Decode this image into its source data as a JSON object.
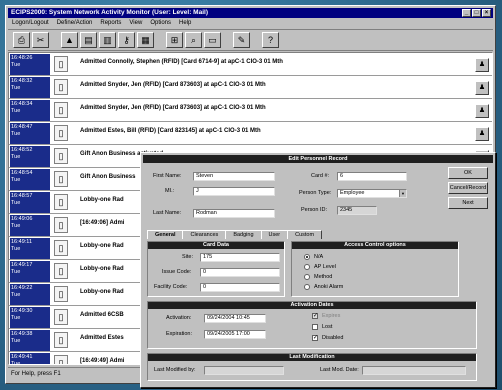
{
  "window": {
    "title": "ECIPS2000: System Network Activity Monitor (User: Level: Mail)",
    "controls": {
      "minimize": "_",
      "maximize": "□",
      "close": "×"
    }
  },
  "menu": [
    "Logon/Logout",
    "Define/Action",
    "Reports",
    "View",
    "Options",
    "Help"
  ],
  "toolbar": {
    "tools": [
      {
        "name": "print-tool",
        "glyph": "⎙"
      },
      {
        "name": "cut-tool",
        "glyph": "✂"
      },
      {
        "name": "alarm-tool",
        "glyph": "▲"
      },
      {
        "name": "report-tool",
        "glyph": "▤"
      },
      {
        "name": "door-tool",
        "glyph": "▥"
      },
      {
        "name": "key-tool",
        "glyph": "⚷"
      },
      {
        "name": "badge-tool",
        "glyph": "▦"
      },
      {
        "name": "monitor-tool",
        "glyph": "⊞"
      },
      {
        "name": "search-tool",
        "glyph": "⌕"
      },
      {
        "name": "card-tool",
        "glyph": "▭"
      },
      {
        "name": "edit-tool",
        "glyph": "✎"
      },
      {
        "name": "help-tool",
        "glyph": "?"
      }
    ]
  },
  "events": [
    {
      "time": "16:48:26",
      "sub": "Tue",
      "msg": "Admitted Connolly, Stephen (RFID) [Card 6714-9] at apC-1 CIO-3 01 Mth"
    },
    {
      "time": "16:48:32",
      "sub": "Tue",
      "msg": "Admitted Snyder, Jen (RFID) [Card 873603] at apC-1 CIO-3 01 Mth"
    },
    {
      "time": "16:48:34",
      "sub": "Tue",
      "msg": "Admitted Snyder, Jen (RFID) [Card 873603] at apC-1 CIO-3 01 Mth"
    },
    {
      "time": "16:48:47",
      "sub": "Tue",
      "msg": "Admitted Estes, Bill (RFID) [Card 823145] at apC-1 CIO-3 01 Mth"
    },
    {
      "time": "16:48:52",
      "sub": "Tue",
      "msg": "Gift Anon Business activated"
    },
    {
      "time": "16:48:54",
      "sub": "Tue",
      "msg": "Gift Anon Business"
    },
    {
      "time": "16:48:57",
      "sub": "Tue",
      "msg": "Lobby-one Rad"
    },
    {
      "time": "16:49:06",
      "sub": "Tue",
      "msg": "[16:49:06] Admi"
    },
    {
      "time": "16:49:11",
      "sub": "Tue",
      "msg": "Lobby-one Rad"
    },
    {
      "time": "16:49:17",
      "sub": "Tue",
      "msg": "Lobby-one Rad"
    },
    {
      "time": "16:49:22",
      "sub": "Tue",
      "msg": "Lobby-one Rad"
    },
    {
      "time": "16:49:30",
      "sub": "Tue",
      "msg": "Admitted 6CSB"
    },
    {
      "time": "16:49:38",
      "sub": "Tue",
      "msg": "Admitted Estes"
    },
    {
      "time": "16:49:41",
      "sub": "Tue",
      "msg": "[16:49:49] Admi"
    },
    {
      "time": "16:49:45",
      "sub": "Tue",
      "msg": "Admitted Mr. S"
    }
  ],
  "status": "For Help, press F1",
  "dialog": {
    "title": "Edit Personnel Record",
    "first_name_label": "First Name:",
    "first_name": "Steven",
    "mi_label": "MI.:",
    "mi": "J",
    "last_name_label": "Last Name:",
    "last_name": "Rodman",
    "card_label": "Card #:",
    "card": "6",
    "person_type_label": "Person Type:",
    "person_type": "Employee",
    "person_id_label": "Person ID:",
    "person_id": "2345",
    "buttons": [
      "OK",
      "Cancel/Record",
      "Next"
    ],
    "tabs": [
      "General",
      "Clearances",
      "Badging",
      "User",
      "Custom"
    ],
    "card_data": {
      "head": "Card Data",
      "site_label": "Site:",
      "site": "175",
      "issue_code_label": "Issue Code:",
      "issue_code": "0",
      "facility_code_label": "Facility Code:",
      "facility_code": "0"
    },
    "access_control": {
      "head": "Access Control options",
      "options": [
        "N/A",
        "AP Level",
        "Method",
        "Anoki Alarm"
      ],
      "selected": 0
    },
    "activation": {
      "head": "Activation Dates",
      "activation_label": "Activation:",
      "activation": "09/24/2004 10:45",
      "expiration_label": "Expiration:",
      "expiration": "09/24/2005 17:00",
      "checks": [
        {
          "label": "Expires",
          "checked": true,
          "disabled": true
        },
        {
          "label": "Lost",
          "checked": false,
          "disabled": false
        },
        {
          "label": "Disabled",
          "checked": true,
          "disabled": false
        }
      ]
    },
    "last_mod": {
      "head": "Last Modification",
      "mod_label": "Last Modified by:",
      "mod": "",
      "date_label": "Last Mod. Date:",
      "date": ""
    }
  }
}
